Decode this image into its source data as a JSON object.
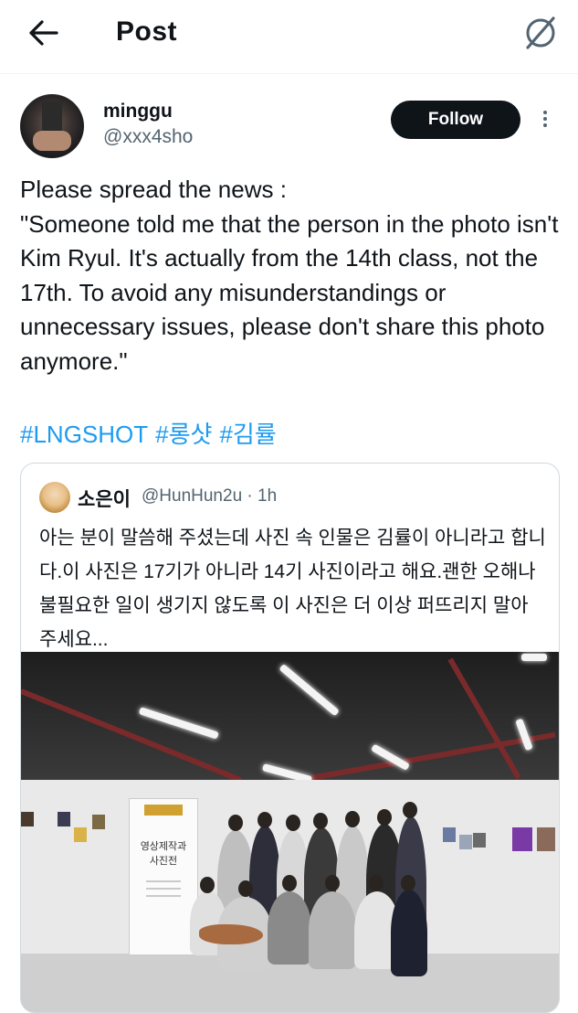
{
  "header": {
    "title": "Post"
  },
  "author": {
    "name": "minggu",
    "handle": "@xxx4sho",
    "follow_label": "Follow"
  },
  "tweet": {
    "text": "Please spread the news :\n\"Someone told me that the person in the photo isn't Kim Ryul. It's actually from the 14th class, not the 17th. To avoid any misunderstandings or unnecessary issues, please don't share this photo anymore.\"",
    "hashtags": [
      "#LNGSHOT",
      "#롱샷",
      "#김률"
    ]
  },
  "quote": {
    "name": "소은이",
    "handle": "@HunHun2u",
    "time": "· 1h",
    "text": "아는 분이 말씀해 주셨는데 사진 속 인물은 김률이 아니라고 합니다.이 사진은 17기가 아니라 14기 사진이라고 해요.괜한 오해나 불필요한 일이 생기지 않도록 이 사진은 더 이상 퍼뜨리지 말아 주세요...",
    "poster_title": "영상제작과\n사진전"
  },
  "colors": {
    "accent": "#1d9bf0",
    "text_primary": "#0f1419",
    "text_secondary": "#536471",
    "follow_bg": "#0f1419"
  }
}
